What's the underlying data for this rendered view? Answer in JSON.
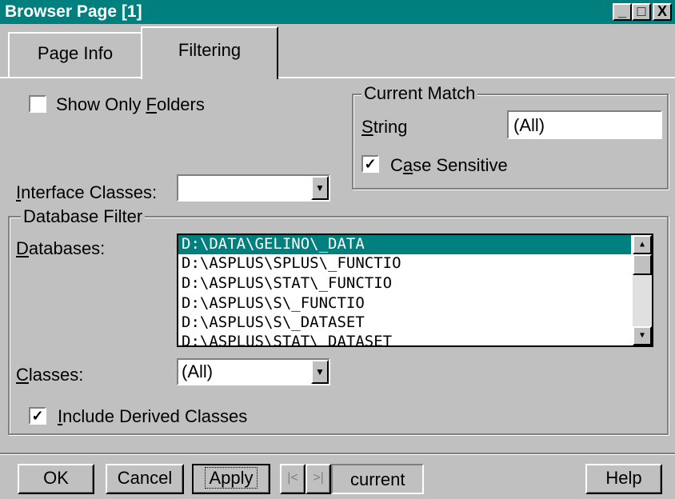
{
  "window": {
    "title": "Browser Page [1]"
  },
  "title_buttons": {
    "minimize": "_",
    "maximize": "□",
    "close": "X"
  },
  "tabs": [
    {
      "label": "Page Info"
    },
    {
      "label": "Filtering"
    }
  ],
  "show_only_folders": {
    "pre": "Show Only ",
    "key": "F",
    "post": "olders",
    "checked": false
  },
  "interface_classes": {
    "pre": "",
    "key": "I",
    "post": "nterface Classes:",
    "value": ""
  },
  "current_match": {
    "title": "Current Match",
    "string_key": "S",
    "string_post": "tring",
    "string_value": "(All)",
    "case_pre": "C",
    "case_key": "a",
    "case_post": "se Sensitive",
    "case_checked": true
  },
  "database_filter": {
    "title": "Database Filter",
    "databases_key": "D",
    "databases_post": "atabases:",
    "databases": [
      "D:\\DATA\\GELINO\\_DATA",
      "D:\\ASPLUS\\SPLUS\\_FUNCTIO",
      "D:\\ASPLUS\\STAT\\_FUNCTIO",
      "D:\\ASPLUS\\S\\_FUNCTIO",
      "D:\\ASPLUS\\S\\_DATASET",
      "D:\\ASPLUS\\STAT\\_DATASET"
    ],
    "classes_key": "C",
    "classes_post": "lasses:",
    "classes_value": "(All)",
    "include_key": "I",
    "include_post": "nclude Derived Classes",
    "include_checked": true
  },
  "buttons": {
    "ok": "OK",
    "cancel": "Cancel",
    "apply": "Apply",
    "help": "Help",
    "prev": "|<",
    "next": ">|",
    "current": "current"
  },
  "colors": {
    "titlebar": "#007f7f",
    "face": "#c0c0c0",
    "selection": "#007f7f"
  }
}
